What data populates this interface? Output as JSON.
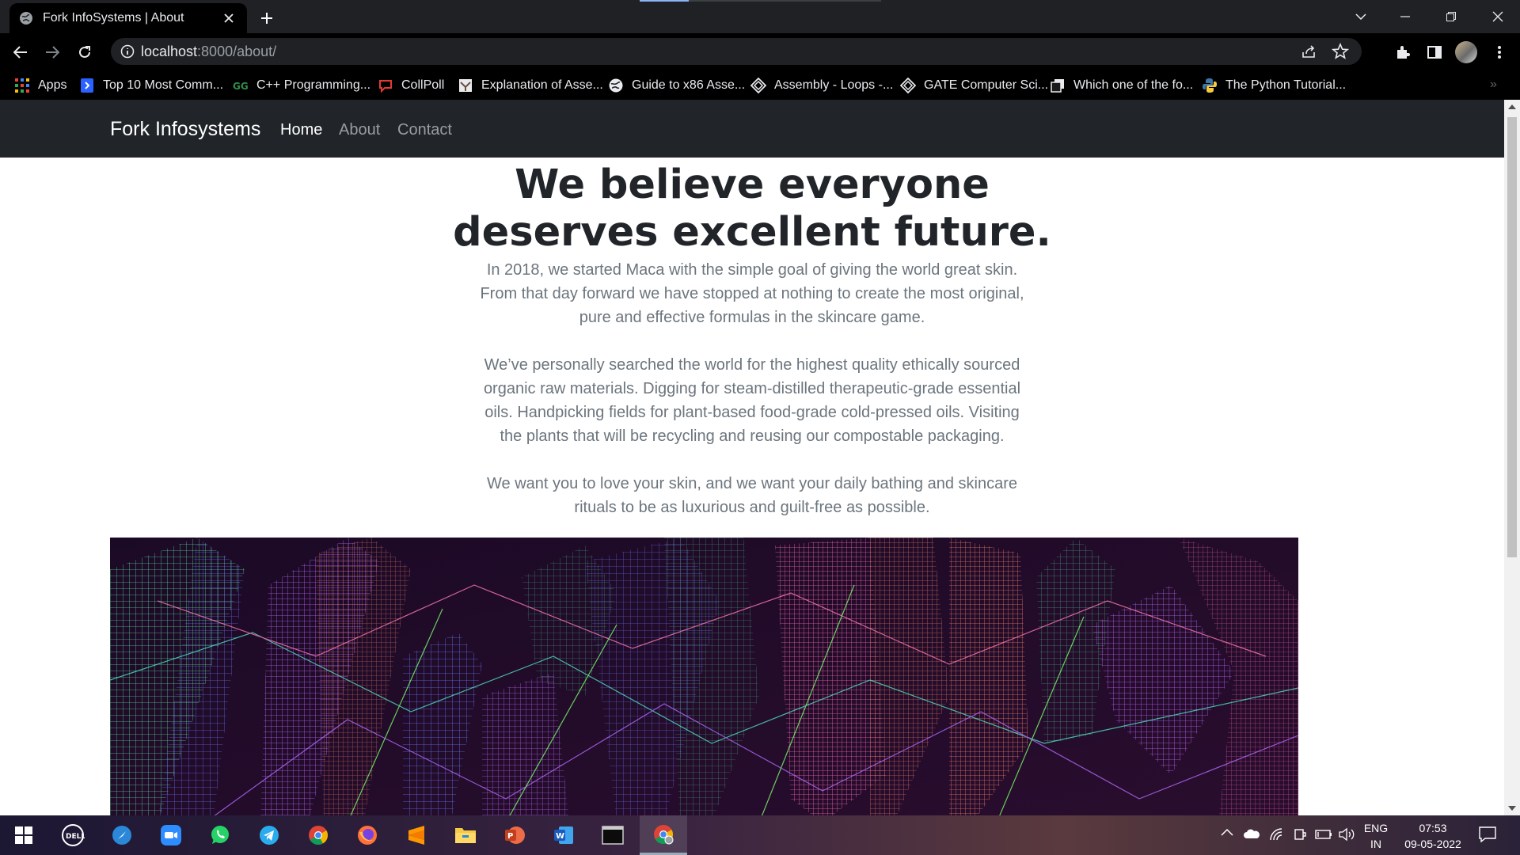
{
  "browser": {
    "tab_title": "Fork InfoSystems | About",
    "url_host": "localhost",
    "url_rest": ":8000/about/"
  },
  "bookmarks": [
    {
      "label": "Apps",
      "icon": "apps-grid-icon"
    },
    {
      "label": "Top 10 Most Comm...",
      "icon": "bookmark-blue-icon"
    },
    {
      "label": "C++ Programming...",
      "icon": "geeksforgeeks-icon"
    },
    {
      "label": "CollPoll",
      "icon": "collpoll-icon"
    },
    {
      "label": "Explanation of Asse...",
      "icon": "stackexchange-icon"
    },
    {
      "label": "Guide to x86 Asse...",
      "icon": "globe-icon"
    },
    {
      "label": "Assembly - Loops -...",
      "icon": "tutorialspoint-icon"
    },
    {
      "label": "GATE Computer Sci...",
      "icon": "tutorialspoint-icon"
    },
    {
      "label": "Which one of the fo...",
      "icon": "bookmark-dark-icon"
    },
    {
      "label": "The Python Tutorial...",
      "icon": "python-icon"
    }
  ],
  "site": {
    "brand": "Fork Infosystems",
    "nav": [
      {
        "label": "Home",
        "active": true
      },
      {
        "label": "About",
        "active": false
      },
      {
        "label": "Contact",
        "active": false
      }
    ],
    "hero_title_line1": "We believe everyone",
    "hero_title_line2": "deserves excellent future.",
    "para1": [
      "In 2018, we started Maca with the simple goal of giving the world great skin.",
      "From that day forward we have stopped at nothing to create the most original,",
      "pure and effective formulas in the skincare game."
    ],
    "para2": [
      "We’ve personally searched the world for the highest quality ethically sourced",
      "organic raw materials. Digging for steam-distilled therapeutic-grade essential",
      "oils. Handpicking fields for plant-based food-grade cold-pressed oils. Visiting",
      "the plants that will be recycling and reusing our compostable packaging."
    ],
    "para3": [
      "We want you to love your skin, and we want your daily bathing and skincare",
      "rituals to be as luxurious and guilt-free as possible."
    ]
  },
  "taskbar": {
    "apps": [
      "windows-start-icon",
      "dell-icon",
      "edge-like-icon",
      "zoom-icon",
      "whatsapp-icon",
      "telegram-icon",
      "chrome-icon",
      "firefox-icon",
      "sublime-icon",
      "file-explorer-icon",
      "powerpoint-icon",
      "word-icon",
      "terminal-icon",
      "chrome-active-icon"
    ],
    "lang_line1": "ENG",
    "lang_line2": "IN",
    "time": "07:53",
    "date": "09-05-2022"
  },
  "colors": {
    "navbar_bg": "#212529",
    "nav_active": "#ffffff",
    "nav_inactive": "#9a9da0",
    "body_text": "#6c757d",
    "title_text": "#212529"
  }
}
